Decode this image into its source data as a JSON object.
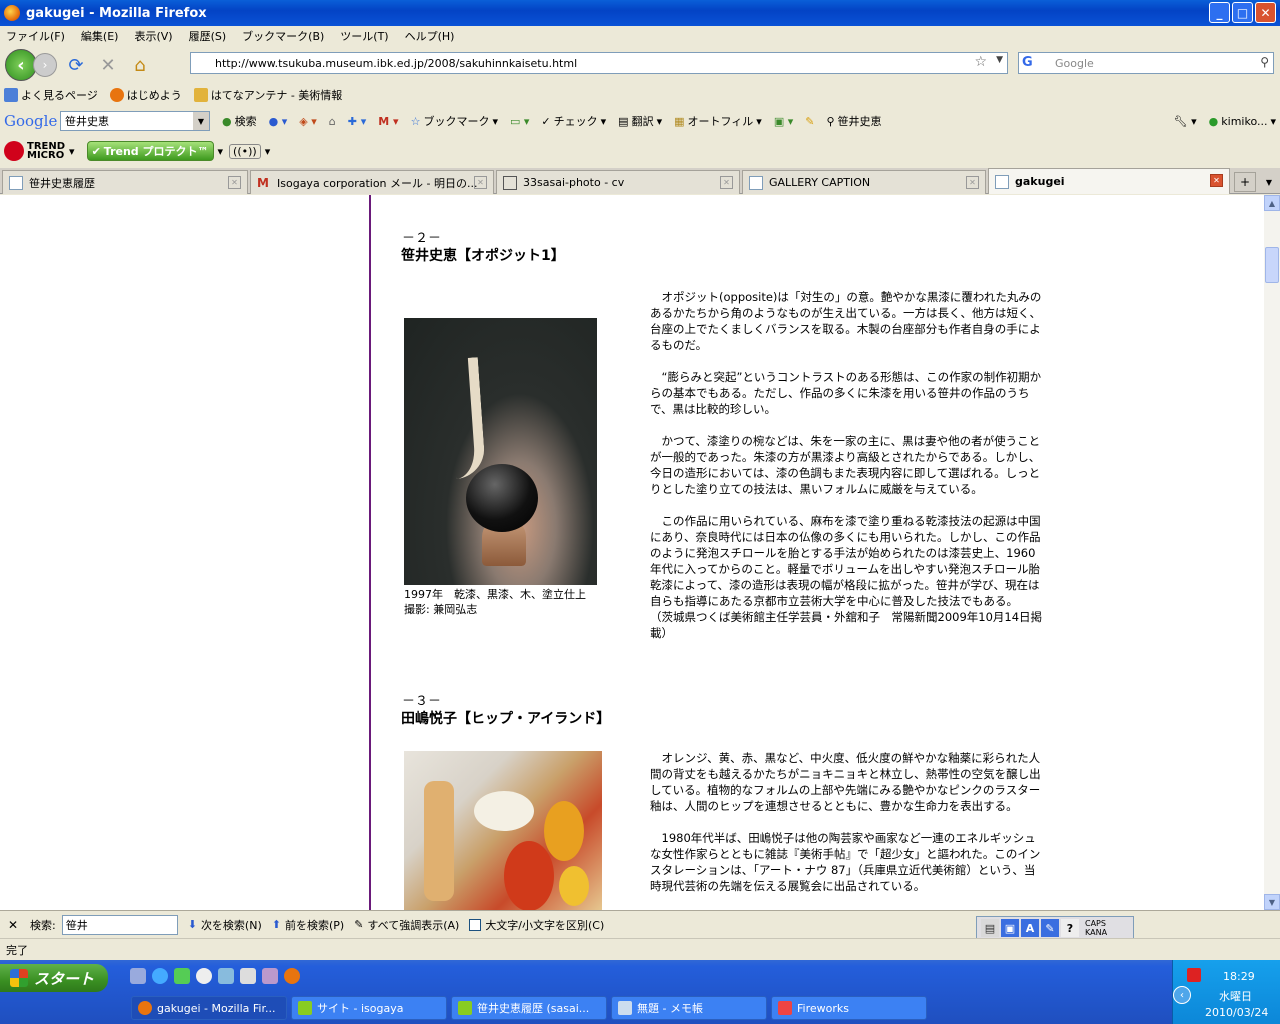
{
  "window": {
    "title": "gakugei - Mozilla Firefox",
    "minimize": "_",
    "maximize": "□",
    "close": "✕"
  },
  "menu": [
    "ファイル(F)",
    "編集(E)",
    "表示(V)",
    "履歴(S)",
    "ブックマーク(B)",
    "ツール(T)",
    "ヘルプ(H)"
  ],
  "nav": {
    "url": "http://www.tsukuba.museum.ibk.ed.jp/2008/sakuhinnkaisetu.html",
    "search_placeholder": "Google"
  },
  "bookmarks": [
    "よく見るページ",
    "はじめよう",
    "はてなアンテナ - 美術情報"
  ],
  "google_toolbar": {
    "logo": "Google",
    "query": "笹井史恵",
    "items": [
      "検索",
      "ブックマーク",
      "チェック",
      "翻訳",
      "オートフィル",
      "笹井史恵"
    ],
    "account": "kimiko..."
  },
  "trend_toolbar": {
    "logo_line1": "TREND",
    "logo_line2": "MICRO",
    "protect": "Trend プロテクト™"
  },
  "tabs": [
    {
      "label": "笹井史恵履歴",
      "active": false
    },
    {
      "label": "Isogaya corporation メール - 明日の...",
      "active": false
    },
    {
      "label": "33sasai-photo - cv",
      "active": false
    },
    {
      "label": "GALLERY CAPTION",
      "active": false
    },
    {
      "label": "gakugei",
      "active": true
    }
  ],
  "content": {
    "section2": {
      "number": "－２－",
      "title": "笹井史恵【オポジット1】",
      "caption_line1": "1997年　乾漆、黒漆、木、塗立仕上",
      "caption_line2": "撮影: 兼岡弘志",
      "paragraphs": [
        "　オポジット(opposite)は「対生の」の意。艶やかな黒漆に覆われた丸みのあるかたちから角のようなものが生え出ている。一方は長く、他方は短く、台座の上でたくましくバランスを取る。木製の台座部分も作者自身の手によるものだ。",
        "　“膨らみと突起”というコントラストのある形態は、この作家の制作初期からの基本でもある。ただし、作品の多くに朱漆を用いる笹井の作品のうちで、黒は比較的珍しい。",
        "　かつて、漆塗りの椀などは、朱を一家の主に、黒は妻や他の者が使うことが一般的であった。朱漆の方が黒漆より高級とされたからである。しかし、今日の造形においては、漆の色調もまた表現内容に即して選ばれる。しっとりとした塗り立ての技法は、黒いフォルムに威厳を与えている。",
        "　この作品に用いられている、麻布を漆で塗り重ねる乾漆技法の起源は中国にあり、奈良時代には日本の仏像の多くにも用いられた。しかし、この作品のように発泡スチロールを胎とする手法が始められたのは漆芸史上、1960年代に入ってからのこと。軽量でボリュームを出しやすい発泡スチロール胎乾漆によって、漆の造形は表現の幅が格段に拡がった。笹井が学び、現在は自らも指導にあたる京都市立芸術大学を中心に普及した技法でもある。\n（茨城県つくば美術館主任学芸員・外舘和子　常陽新聞2009年10月14日掲載）"
      ]
    },
    "section3": {
      "number": "－３－",
      "title": "田嶋悦子【ヒップ・アイランド】",
      "paragraphs": [
        "　オレンジ、黄、赤、黒など、中火度、低火度の鮮やかな釉薬に彩られた人間の背丈をも越えるかたちがニョキニョキと林立し、熱帯性の空気を醸し出している。植物的なフォルムの上部や先端にみる艶やかなピンクのラスター釉は、人間のヒップを連想させるとともに、豊かな生命力を表出する。",
        "　1980年代半ば、田嶋悦子は他の陶芸家や画家など一連のエネルギッシュな女性作家らとともに雑誌『美術手帖』で「超少女」と謳われた。このインスタレーションは、「アート・ナウ 87」（兵庫県立近代美術館）という、当時現代芸術の先端を伝える展覧会に出品されている。"
      ]
    }
  },
  "findbar": {
    "close": "✕",
    "label": "検索:",
    "query": "笹井",
    "next": "次を検索(N)",
    "prev": "前を検索(P)",
    "highlight": "すべて強調表示(A)",
    "match_case": "大文字/小文字を区別(C)"
  },
  "ime": {
    "caps": "CAPS",
    "kana": "KANA"
  },
  "status": "完了",
  "taskbar": {
    "start": "スタート",
    "buttons": [
      {
        "label": "gakugei - Mozilla Fir...",
        "active": true
      },
      {
        "label": "サイト - isogaya",
        "active": false
      },
      {
        "label": "笹井史恵履歴 (sasai...",
        "active": false
      },
      {
        "label": "無題 - メモ帳",
        "active": false
      },
      {
        "label": "Fireworks",
        "active": false
      }
    ],
    "time": "18:29",
    "day": "水曜日",
    "date": "2010/03/24"
  },
  "colors": {
    "divider": "#6a1a7a",
    "titlebar": "#0343c5",
    "taskbar": "#245edb"
  }
}
